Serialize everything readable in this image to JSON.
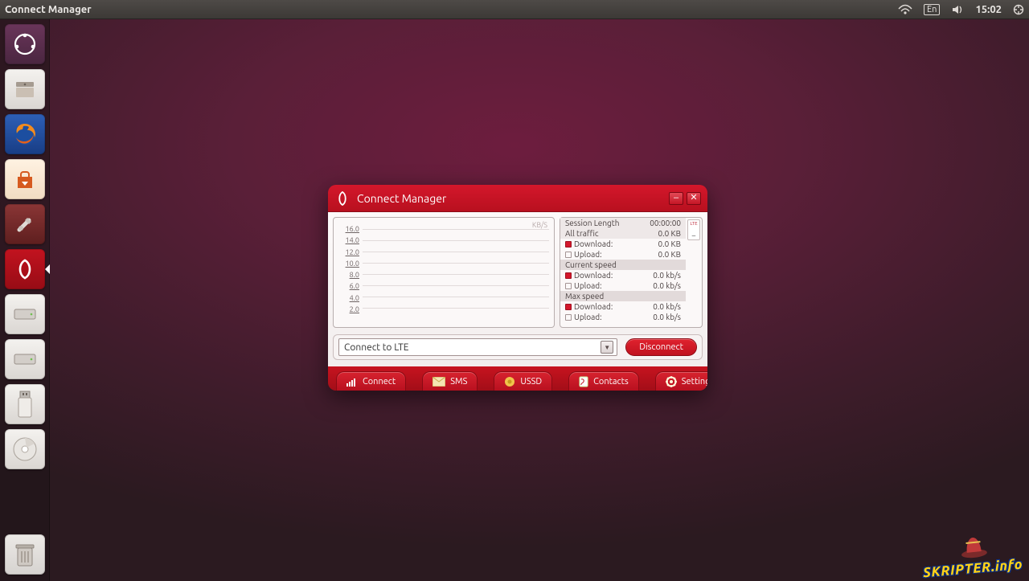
{
  "top_panel": {
    "app_title": "Connect Manager",
    "lang": "En",
    "time": "15:02"
  },
  "launcher": {
    "items": [
      {
        "name": "dash-icon"
      },
      {
        "name": "files-icon"
      },
      {
        "name": "firefox-icon"
      },
      {
        "name": "software-center-icon"
      },
      {
        "name": "settings-icon"
      },
      {
        "name": "connect-manager-icon"
      },
      {
        "name": "drive-icon"
      },
      {
        "name": "drive-icon-2"
      },
      {
        "name": "usb-drive-icon"
      },
      {
        "name": "optical-drive-icon"
      }
    ],
    "trash_name": "trash-icon"
  },
  "app_window": {
    "title": "Connect Manager",
    "chart_unit": "KB/S",
    "stats": {
      "session_length": {
        "label": "Session Length",
        "value": "00:00:00"
      },
      "all_traffic": {
        "label": "All traffic",
        "value": "0.0 KB"
      },
      "traffic_download": {
        "label": "Download:",
        "value": "0.0 KB"
      },
      "traffic_upload": {
        "label": "Upload:",
        "value": "0.0 KB"
      },
      "current_speed_header": "Current speed",
      "current_download": {
        "label": "Download:",
        "value": "0.0 kb/s"
      },
      "current_upload": {
        "label": "Upload:",
        "value": "0.0 kb/s"
      },
      "max_speed_header": "Max speed",
      "max_download": {
        "label": "Download:",
        "value": "0.0 kb/s"
      },
      "max_upload": {
        "label": "Upload:",
        "value": "0.0 kb/s"
      },
      "badge": "LTE",
      "badge_signal": "_"
    },
    "connection": {
      "selected": "Connect to LTE",
      "button": "Disconnect"
    },
    "tabs": {
      "connect": "Connect",
      "sms": "SMS",
      "ussd": "USSD",
      "contacts": "Contacts",
      "settings": "Settings"
    }
  },
  "watermark": "SKRIPTER.info",
  "chart_data": {
    "type": "line",
    "title": "",
    "xlabel": "",
    "ylabel": "KB/S",
    "ylim": [
      0,
      16
    ],
    "y_ticks": [
      2.0,
      4.0,
      6.0,
      8.0,
      10.0,
      12.0,
      14.0,
      16.0
    ],
    "series": [
      {
        "name": "Download",
        "values": []
      },
      {
        "name": "Upload",
        "values": []
      }
    ]
  }
}
